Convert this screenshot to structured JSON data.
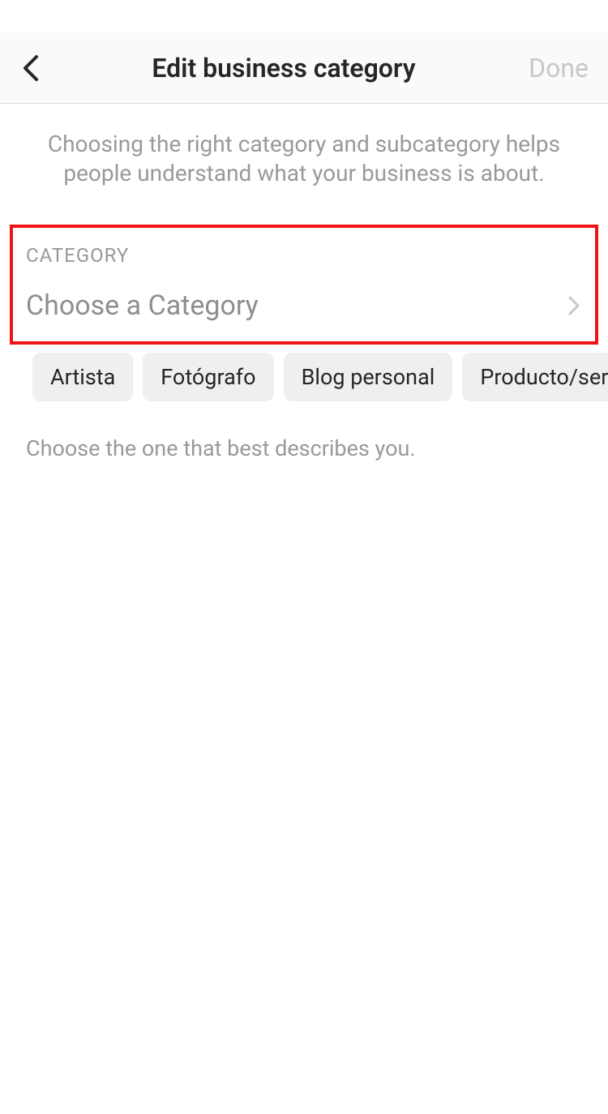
{
  "header": {
    "title": "Edit business category",
    "done_label": "Done"
  },
  "description": "Choosing the right category and subcategory helps people understand what your business is about.",
  "category": {
    "section_label": "CATEGORY",
    "placeholder": "Choose a Category"
  },
  "chips": [
    "Artista",
    "Fotógrafo",
    "Blog personal",
    "Producto/serv"
  ],
  "hint": "Choose the one that best describes you."
}
